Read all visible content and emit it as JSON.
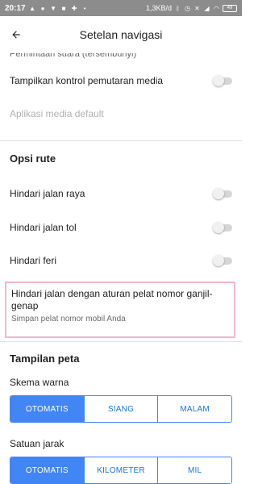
{
  "status_bar": {
    "time": "20:17",
    "net_speed": "1,3KB/d",
    "battery": "49"
  },
  "app_bar": {
    "title": "Setelan navigasi"
  },
  "media": {
    "cut_label": "Permintaan suara (tersembunyi)",
    "media_controls_label": "Tampilkan kontrol pemutaran media",
    "default_media_app_label": "Aplikasi media default"
  },
  "route_options": {
    "header": "Opsi rute",
    "avoid_highways": "Hindari jalan raya",
    "avoid_tolls": "Hindari jalan tol",
    "avoid_ferries": "Hindari feri",
    "odd_even_title": "Hindari jalan dengan aturan pelat nomor ganjil-genap",
    "odd_even_subtitle": "Simpan pelat nomor mobil Anda"
  },
  "map_display": {
    "header": "Tampilan peta",
    "color_scheme_label": "Skema warna",
    "color_scheme_options": [
      "OTOMATIS",
      "SIANG",
      "MALAM"
    ],
    "color_scheme_selected": "OTOMATIS",
    "distance_units_label": "Satuan jarak",
    "distance_units_options": [
      "OTOMATIS",
      "KILOMETER",
      "MIL"
    ],
    "distance_units_selected": "OTOMATIS"
  },
  "colors": {
    "accent": "#4285f4",
    "status_bar": "#8c8c8c",
    "highlight_border": "#f2b7cf"
  }
}
